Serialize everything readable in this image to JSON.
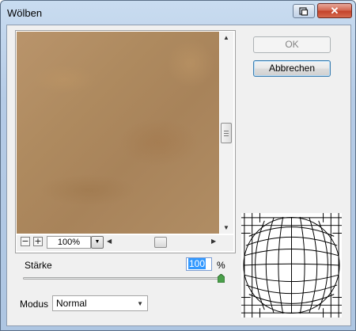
{
  "window": {
    "title": "Wölben"
  },
  "titlebar": {
    "close_glyph": "✕"
  },
  "preview": {
    "zoom_out_label": "−",
    "zoom_in_label": "+",
    "zoom_value": "100%"
  },
  "buttons": {
    "ok_label": "OK",
    "cancel_label": "Abbrechen"
  },
  "amount": {
    "label": "Stärke",
    "value": "100",
    "unit": "%"
  },
  "mode": {
    "label": "Modus",
    "selected": "Normal"
  },
  "colors": {
    "close": "#c4432b",
    "selection": "#3399ff",
    "slider_thumb": "#4aa04a"
  },
  "icons": [
    "help-icon",
    "close-icon",
    "scroll-up-icon",
    "scroll-down-icon",
    "scroll-left-icon",
    "scroll-right-icon",
    "dropdown-arrow-icon",
    "spherize-globe-icon"
  ]
}
